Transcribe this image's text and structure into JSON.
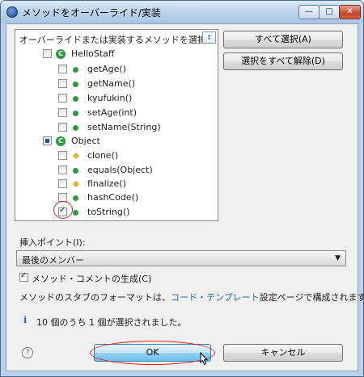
{
  "window": {
    "title": "メソッドをオーバーライド/実装",
    "min_glyph": "—",
    "max_glyph": "□",
    "close_glyph": "✕"
  },
  "header": {
    "prompt": "オーバーライドまたは実装するメソッドを選択:",
    "toggle_icon": "sort-members-icon"
  },
  "tree": {
    "groups": [
      {
        "name": "HelloStaff",
        "state": "unchecked",
        "items": [
          {
            "label": "getAge()",
            "icon": "public-method-icon",
            "checked": false
          },
          {
            "label": "getName()",
            "icon": "public-method-icon",
            "checked": false
          },
          {
            "label": "kyufukin()",
            "icon": "public-method-icon",
            "checked": false
          },
          {
            "label": "setAge(int)",
            "icon": "public-method-icon",
            "checked": false
          },
          {
            "label": "setName(String)",
            "icon": "public-method-icon",
            "checked": false
          }
        ]
      },
      {
        "name": "Object",
        "state": "partial",
        "items": [
          {
            "label": "clone()",
            "icon": "protected-method-icon",
            "checked": false
          },
          {
            "label": "equals(Object)",
            "icon": "public-method-icon",
            "checked": false
          },
          {
            "label": "finalize()",
            "icon": "protected-method-icon",
            "checked": false
          },
          {
            "label": "hashCode()",
            "icon": "public-method-icon",
            "checked": false
          },
          {
            "label": "toString()",
            "icon": "public-method-icon",
            "checked": true
          }
        ]
      }
    ]
  },
  "buttons": {
    "select_all": "すべて選択(A)",
    "deselect_all": "選択をすべて解除(D)",
    "ok": "OK",
    "cancel": "キャンセル"
  },
  "insertion": {
    "label": "挿入ポイント(I):",
    "value": "最後のメンバー"
  },
  "generate_comments": {
    "label": "メソッド・コメントの生成(C)",
    "checked": true
  },
  "format_note": {
    "prefix": "メソッドのスタブのフォーマットは、",
    "link": "コード・テンプレート",
    "suffix": "設定ページで構成されます。"
  },
  "status": {
    "icon": "info-icon",
    "text": "10 個のうち 1 個が選択されました。"
  },
  "help_icon": "help-icon",
  "colors": {
    "accent_link": "#1764c0",
    "highlight_red": "#e02020",
    "method_green": "#2e9a3d",
    "protected_yellow": "#e8b23a"
  }
}
